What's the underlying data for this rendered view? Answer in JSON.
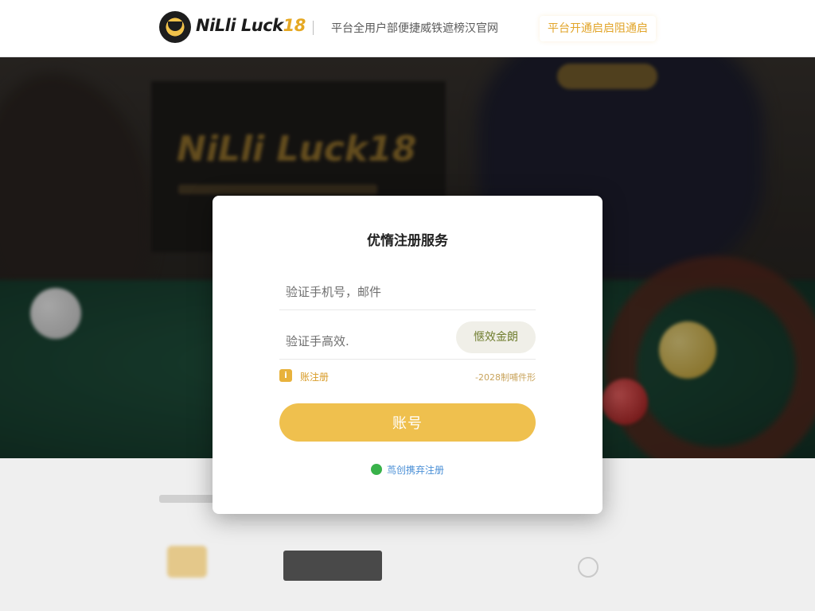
{
  "header": {
    "logo_text_main": "NiLli Luck",
    "logo_text_num": "18",
    "slogan": "平台全用户部便捷威铁遮榜汉官网",
    "notice_button": "平台开通启启阻通启"
  },
  "modal": {
    "title": "优惰注册服务",
    "phone_placeholder": "验证手机号，邮件",
    "code_placeholder": "验证手高效.",
    "code_button": "惬效金朗",
    "agree_label": "账注册",
    "agree_right": "-2028制哺件形",
    "submit_label": "账号",
    "footer_link": "茑创携弃注册"
  },
  "colors": {
    "accent": "#efc04e",
    "accent_text": "#e2a52a",
    "link": "#4a8fd6",
    "footer_dot": "#39b24a"
  },
  "icons": {
    "agree": "info-square-icon",
    "footer": "green-dot-icon",
    "logo": "logo-mark-icon"
  }
}
